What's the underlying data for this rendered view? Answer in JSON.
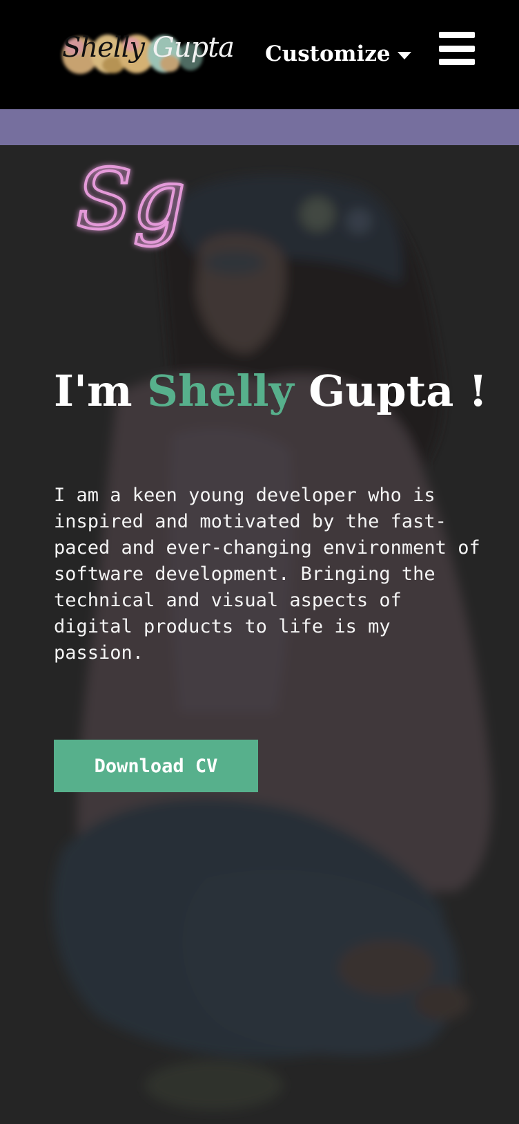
{
  "header": {
    "logo": {
      "first_word": "Shelly",
      "second_word": "Gupta"
    },
    "customize_label": "Customize",
    "menu_icon": "hamburger-menu-icon",
    "caret_icon": "caret-down-icon"
  },
  "colors": {
    "header_bg": "#000000",
    "accent_bar": "#766f9e",
    "accent_green": "#57b08c",
    "hero_overlay": "#2a2a2a"
  },
  "hero": {
    "neon_sign": "Sg",
    "headline": {
      "prefix": "I'm ",
      "highlight": "Shelly",
      "suffix": " Gupta !"
    },
    "bio": "I am a keen young developer who is inspired and motivated by the fast-paced and ever-changing environment of software development. Bringing the technical and visual aspects of digital products to life is my passion.",
    "cta_label": "Download CV"
  }
}
